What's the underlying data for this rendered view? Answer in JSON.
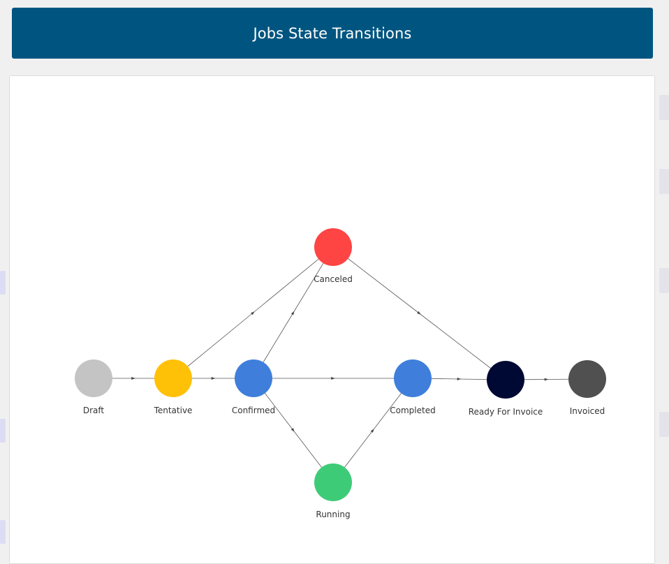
{
  "header": {
    "title": "Jobs State Transitions"
  },
  "diagram": {
    "nodes": [
      {
        "id": "draft",
        "label": "Draft",
        "color": "#c4c4c4"
      },
      {
        "id": "tentative",
        "label": "Tentative",
        "color": "#ffc107"
      },
      {
        "id": "confirmed",
        "label": "Confirmed",
        "color": "#3f7fdb"
      },
      {
        "id": "canceled",
        "label": "Canceled",
        "color": "#ff4444"
      },
      {
        "id": "completed",
        "label": "Completed",
        "color": "#3f7fdb"
      },
      {
        "id": "running",
        "label": "Running",
        "color": "#3ecb78"
      },
      {
        "id": "ready_for_invoice",
        "label": "Ready For Invoice",
        "color": "#000933"
      },
      {
        "id": "invoiced",
        "label": "Invoiced",
        "color": "#505050"
      }
    ],
    "edges": [
      {
        "from": "draft",
        "to": "tentative"
      },
      {
        "from": "tentative",
        "to": "confirmed"
      },
      {
        "from": "tentative",
        "to": "canceled"
      },
      {
        "from": "confirmed",
        "to": "canceled"
      },
      {
        "from": "confirmed",
        "to": "completed"
      },
      {
        "from": "confirmed",
        "to": "running"
      },
      {
        "from": "running",
        "to": "completed"
      },
      {
        "from": "canceled",
        "to": "ready_for_invoice"
      },
      {
        "from": "completed",
        "to": "ready_for_invoice"
      },
      {
        "from": "ready_for_invoice",
        "to": "invoiced"
      }
    ]
  }
}
